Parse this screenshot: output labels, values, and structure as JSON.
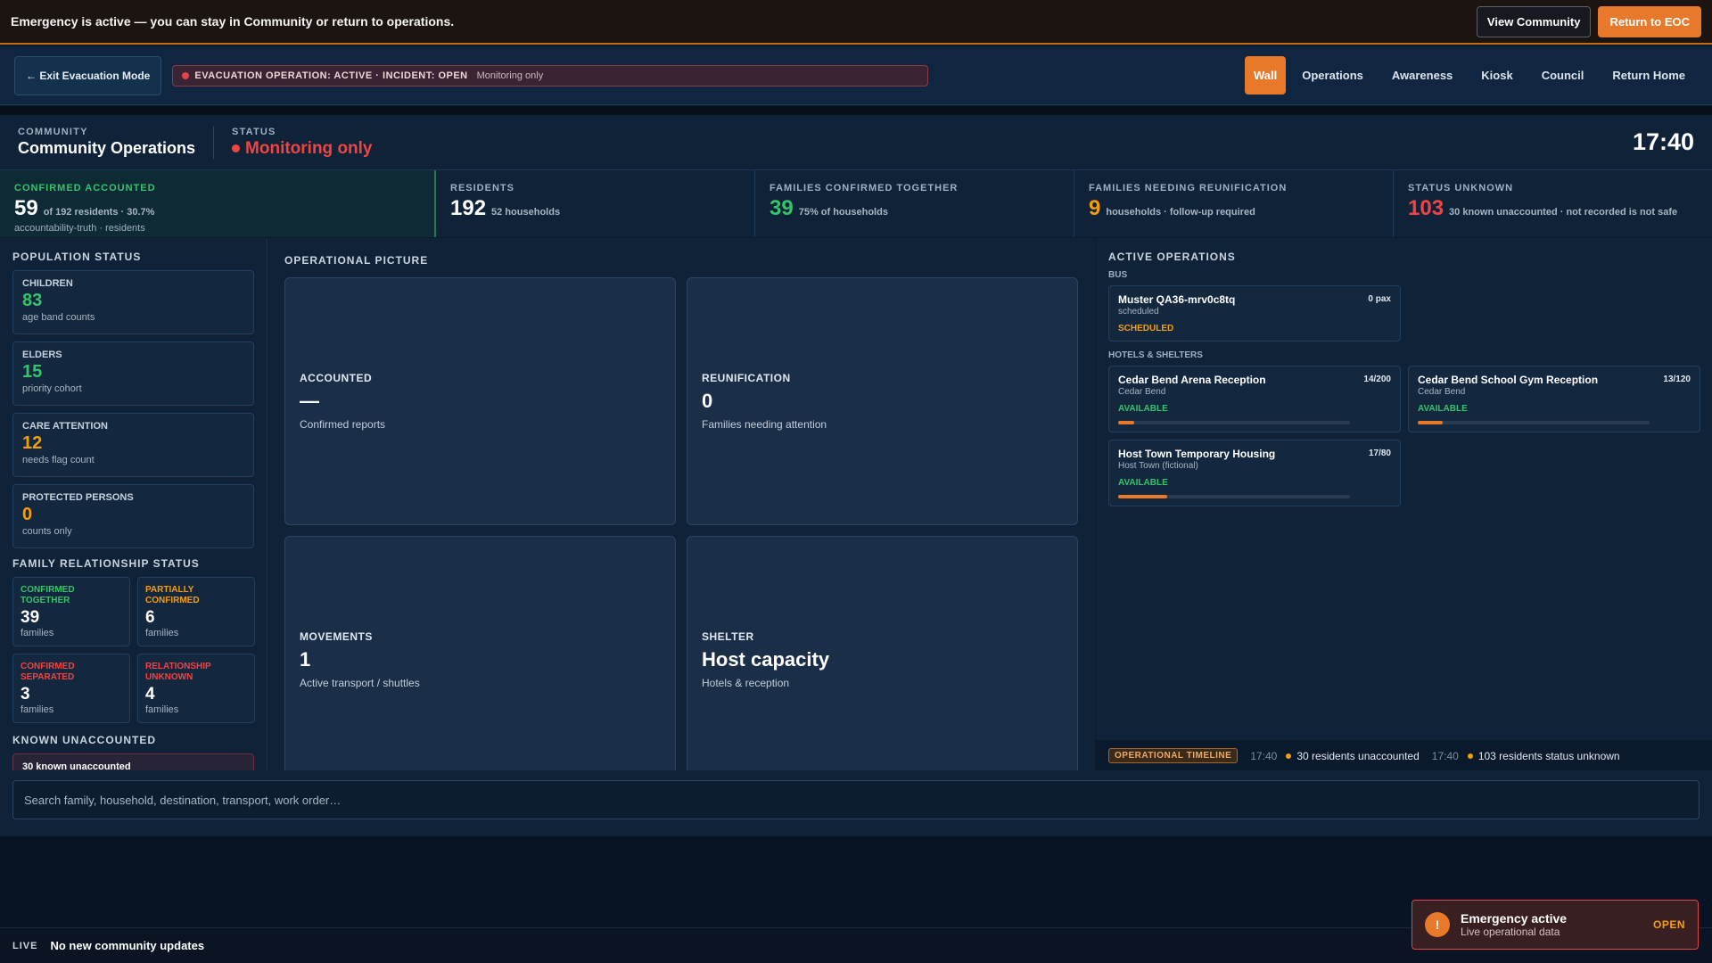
{
  "emergency_bar": {
    "message": "Emergency is active — you can stay in Community or return to operations.",
    "view_community": "View Community",
    "return_eoc": "Return to EOC"
  },
  "nav": {
    "exit_label": "← Exit Evacuation Mode",
    "banner_title": "EVACUATION OPERATION: ACTIVE · INCIDENT: OPEN",
    "banner_sub": "Monitoring only",
    "tabs": [
      "Wall",
      "Operations",
      "Awareness",
      "Kiosk",
      "Council",
      "Return Home"
    ]
  },
  "header": {
    "community_label": "COMMUNITY",
    "community_value": "Community Operations",
    "status_label": "STATUS",
    "status_value": "Monitoring only",
    "clock": "17:40"
  },
  "stats": {
    "confirmed": {
      "label": "CONFIRMED ACCOUNTED",
      "num": "59",
      "desc": "of 192 residents · 30.7%",
      "sub": "accountability-truth · residents"
    },
    "residents": {
      "label": "RESIDENTS",
      "num": "192",
      "desc": "52 households"
    },
    "families_together": {
      "label": "FAMILIES CONFIRMED TOGETHER",
      "num": "39",
      "desc": "75% of households"
    },
    "families_reunification": {
      "label": "FAMILIES NEEDING REUNIFICATION",
      "num": "9",
      "desc": "households · follow-up required"
    },
    "status_unknown": {
      "label": "STATUS UNKNOWN",
      "num": "103",
      "desc": "30 known unaccounted · not recorded is not safe"
    }
  },
  "population": {
    "title": "POPULATION STATUS",
    "cards": [
      {
        "label": "CHILDREN",
        "num": "83",
        "desc": "age band counts"
      },
      {
        "label": "ELDERS",
        "num": "15",
        "desc": "priority cohort"
      },
      {
        "label": "CARE ATTENTION",
        "num": "12",
        "desc": "needs flag count"
      },
      {
        "label": "PROTECTED PERSONS",
        "num": "0",
        "desc": "counts only"
      }
    ]
  },
  "family": {
    "title": "FAMILY RELATIONSHIP STATUS",
    "cards": [
      {
        "label": "CONFIRMED TOGETHER",
        "num": "39",
        "desc": "families"
      },
      {
        "label": "PARTIALLY CONFIRMED",
        "num": "6",
        "desc": "families"
      },
      {
        "label": "CONFIRMED SEPARATED",
        "num": "3",
        "desc": "families"
      },
      {
        "label": "RELATIONSHIP UNKNOWN",
        "num": "4",
        "desc": "families"
      }
    ]
  },
  "unaccounted": {
    "title": "KNOWN UNACCOUNTED",
    "card_text": "30 known unaccounted"
  },
  "operational": {
    "title": "OPERATIONAL PICTURE",
    "cards": [
      {
        "label": "ACCOUNTED",
        "value": "—",
        "desc": "Confirmed reports"
      },
      {
        "label": "REUNIFICATION",
        "value": "0",
        "desc": "Families needing attention"
      },
      {
        "label": "MOVEMENTS",
        "value": "1",
        "desc": "Active transport / shuttles"
      },
      {
        "label": "SHELTER",
        "value": "Host capacity",
        "desc": "Hotels & reception"
      }
    ]
  },
  "active_ops": {
    "title": "ACTIVE OPERATIONS",
    "bus_label": "BUS",
    "bus": {
      "name": "Muster QA36-mrv0c8tq",
      "sub": "scheduled",
      "cap": "0 pax",
      "status": "SCHEDULED"
    },
    "shelters_label": "HOTELS & SHELTERS",
    "shelters": [
      {
        "name": "Cedar Bend Arena Reception",
        "loc": "Cedar Bend",
        "cap": "14/200",
        "status": "AVAILABLE",
        "fill": 0.07
      },
      {
        "name": "Cedar Bend School Gym Reception",
        "loc": "Cedar Bend",
        "cap": "13/120",
        "status": "AVAILABLE",
        "fill": 0.108
      },
      {
        "name": "Host Town Temporary Housing",
        "loc": "Host Town (fictional)",
        "cap": "17/80",
        "status": "AVAILABLE",
        "fill": 0.2125
      }
    ]
  },
  "timeline": {
    "badge": "OPERATIONAL TIMELINE",
    "items": [
      {
        "time": "17:40",
        "text": "30 residents unaccounted"
      },
      {
        "time": "17:40",
        "text": "103 residents status unknown"
      }
    ]
  },
  "search": {
    "placeholder": "Search family, household, destination, transport, work order…"
  },
  "live": {
    "tag": "LIVE",
    "message": "No new community updates"
  },
  "toast": {
    "title": "Emergency active",
    "sub": "Live operational data",
    "action": "OPEN",
    "icon": "alert-icon"
  },
  "colors": {
    "accent": "#e8782a",
    "green": "#34c46a",
    "orange": "#f59e0b",
    "red": "#ef4444"
  }
}
